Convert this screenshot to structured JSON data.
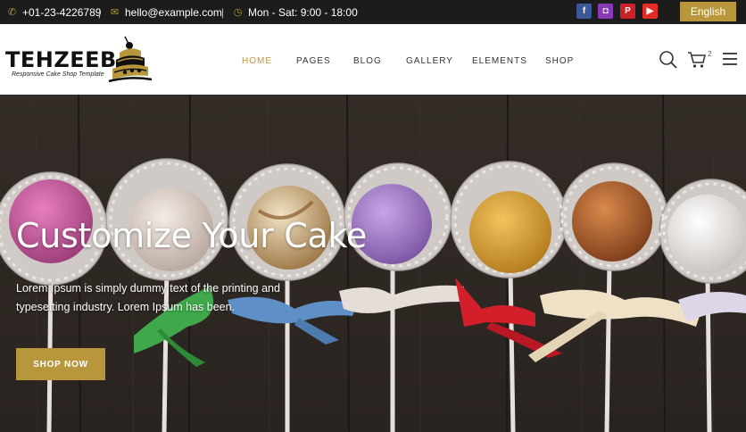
{
  "topbar": {
    "phone": "+01-23-4226789",
    "email": "hello@example.com",
    "hours": "Mon - Sat: 9:00 - 18:00",
    "separator": "|",
    "language": "English",
    "social": [
      {
        "name": "facebook-icon",
        "glyph": "f",
        "color": "#3b5998"
      },
      {
        "name": "instagram-icon",
        "glyph": "◘",
        "color": "#8a3ab9"
      },
      {
        "name": "pinterest-icon",
        "glyph": "P",
        "color": "#cb2027"
      },
      {
        "name": "youtube-icon",
        "glyph": "▶",
        "color": "#e52d27"
      }
    ]
  },
  "header": {
    "logo_text": "TEHZEEB",
    "logo_tagline": "Responsive Cake Shop Template",
    "nav": [
      {
        "label": "HOME",
        "active": true
      },
      {
        "label": "PAGES",
        "active": false
      },
      {
        "label": "BLOG",
        "active": false
      },
      {
        "label": "GALLERY",
        "active": false
      },
      {
        "label": "ELEMENTS",
        "active": false
      },
      {
        "label": "SHOP",
        "active": false
      }
    ],
    "cart_count": "2"
  },
  "hero": {
    "title": "Customize Your Cake",
    "description": "Lorem Ipsum is simply dummy text of the printing and typesetting industry. Lorem Ipsum has been.",
    "button_label": "SHOP NOW"
  },
  "colors": {
    "accent": "#b8973c",
    "topbar_bg": "#1c1c1c"
  }
}
